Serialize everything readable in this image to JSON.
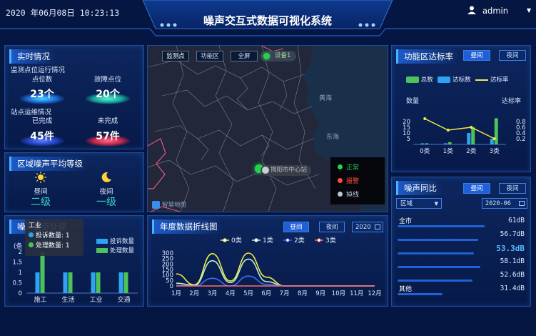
{
  "header": {
    "datetime": "2020 年06月08日 10:23:13",
    "title": "噪声交互式数据可视化系统",
    "user": "admin"
  },
  "realtime": {
    "title": "实时情况",
    "monitor_label": "监测点位运行情况",
    "points_label": "点位数",
    "points_value": "23个",
    "fault_label": "故障点位",
    "fault_value": "20个",
    "ops_label": "站点运维情况",
    "done_label": "已完成",
    "done_value": "45件",
    "undone_label": "未完成",
    "undone_value": "57件"
  },
  "region_level": {
    "title": "区域噪声平均等级",
    "day_label": "昼间",
    "day_value": "二级",
    "night_label": "夜间",
    "night_value": "一级"
  },
  "complaints": {
    "title": "噪声投诉处理",
    "unit": "(条",
    "tooltip_title": "工业",
    "tooltip_complaints": "投诉数量: 1",
    "tooltip_handled": "处理数量: 1",
    "legend": [
      "投诉数量",
      "处理数量"
    ],
    "colors": {
      "complaints": "#2ea3f2",
      "handled": "#4cc35a"
    },
    "chart_data": {
      "type": "bar",
      "categories": [
        "施工",
        "生活",
        "工业",
        "交通"
      ],
      "series": [
        {
          "name": "投诉数量",
          "values": [
            1,
            1,
            1,
            1
          ]
        },
        {
          "name": "处理数量",
          "values": [
            2,
            1,
            1,
            1
          ]
        }
      ],
      "yticks": [
        "2",
        "1.5",
        "1",
        "0.5",
        "0"
      ],
      "ylim": [
        0,
        2
      ]
    }
  },
  "map": {
    "tabs": [
      "监测点",
      "功能区",
      "全屏"
    ],
    "device_label": "设备1",
    "sea_labels": [
      "黄海",
      "东海"
    ],
    "popup": "揭阳市中心站",
    "legend": [
      {
        "label": "正常",
        "color": "#27d150"
      },
      {
        "label": "报警",
        "color": "#ff4b3a"
      },
      {
        "label": "掉线",
        "color": "#bfc6d0"
      }
    ],
    "logo": "智慧地图"
  },
  "annual": {
    "title": "年度数据折线图",
    "btn_day": "昼间",
    "btn_night": "夜间",
    "year": "2020",
    "legend": [
      "0类",
      "1类",
      "2类",
      "3类"
    ],
    "colors": [
      "#f4e94a",
      "#b8f3c7",
      "#3f6bff",
      "#ff6b6b"
    ],
    "chart_data": {
      "type": "line",
      "categories": [
        "1月",
        "2月",
        "3月",
        "4月",
        "5月",
        "6月",
        "7月",
        "8月",
        "9月",
        "10月",
        "11月",
        "12月"
      ],
      "series": [
        {
          "name": "0类",
          "values": [
            110,
            10,
            295,
            45,
            300,
            80,
            0,
            0,
            0,
            0,
            0,
            0
          ]
        },
        {
          "name": "1类",
          "values": [
            25,
            5,
            230,
            30,
            245,
            40,
            0,
            0,
            0,
            0,
            0,
            0
          ]
        },
        {
          "name": "2类",
          "values": [
            5,
            0,
            70,
            0,
            90,
            15,
            0,
            0,
            0,
            0,
            0,
            0
          ]
        },
        {
          "name": "3类",
          "values": [
            0,
            0,
            0,
            0,
            0,
            0,
            0,
            0,
            0,
            0,
            0,
            0
          ]
        }
      ],
      "yticks": [
        "300",
        "250",
        "200",
        "150",
        "100",
        "50",
        "0"
      ],
      "ylim": [
        0,
        300
      ]
    }
  },
  "compliance": {
    "title": "功能区达标率",
    "btn_day": "昼间",
    "btn_night": "夜间",
    "legend": [
      "总数",
      "达标数",
      "达标率"
    ],
    "left_axis_label": "数量",
    "right_axis_label": "达标率",
    "colors": {
      "total": "#4cc35a",
      "ok": "#2ea3f2",
      "rate": "#f4e94a"
    },
    "chart_data": {
      "type": "bar",
      "categories": [
        "0类",
        "1类",
        "2类",
        "3类"
      ],
      "series": [
        {
          "name": "总数",
          "values": [
            1,
            2,
            15,
            23
          ]
        },
        {
          "name": "达标数",
          "values": [
            1,
            1,
            10,
            5
          ]
        },
        {
          "name": "达标率",
          "values": [
            0.9,
            0.5,
            0.6,
            0.2
          ]
        }
      ],
      "yticks_left": [
        "20",
        "15",
        "10",
        "5"
      ],
      "yticks_right": [
        "0.8",
        "0.6",
        "0.4",
        "0.2"
      ],
      "ylim": [
        0,
        25
      ],
      "y2lim": [
        0,
        1
      ]
    }
  },
  "yoy": {
    "title": "噪声同比",
    "btn_day": "昼间",
    "btn_night": "夜间",
    "region_placeholder": "区域",
    "month": "2020-06",
    "rows": [
      {
        "name": "全市",
        "value": "61dB",
        "highlight": false
      },
      {
        "name": "",
        "value": "56.7dB",
        "highlight": false
      },
      {
        "name": "",
        "value": "53.3dB",
        "highlight": true
      },
      {
        "name": "",
        "value": "58.1dB",
        "highlight": false
      },
      {
        "name": "",
        "value": "52.6dB",
        "highlight": false
      },
      {
        "name": "其他",
        "value": "31.4dB",
        "highlight": false
      }
    ],
    "chart_data": {
      "type": "bar",
      "categories": [
        "全市",
        "",
        "",
        "",
        "",
        "其他"
      ],
      "values": [
        61,
        56.7,
        53.3,
        58.1,
        52.6,
        31.4
      ]
    }
  }
}
